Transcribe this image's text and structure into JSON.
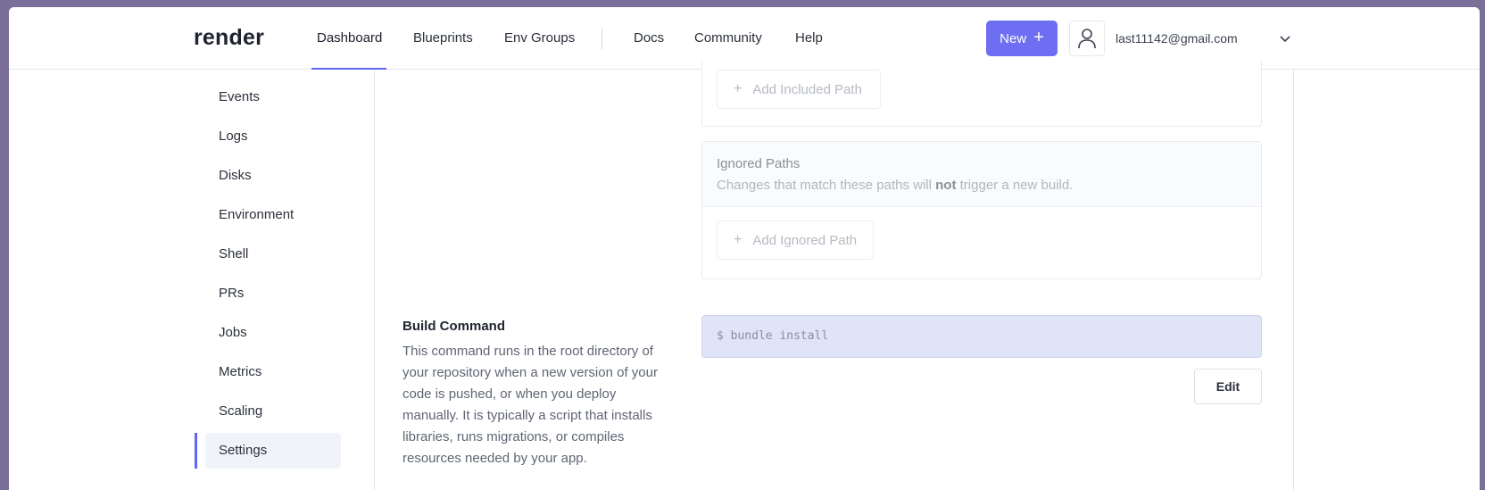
{
  "header": {
    "logo": "render",
    "nav": [
      {
        "label": "Dashboard"
      },
      {
        "label": "Blueprints"
      },
      {
        "label": "Env Groups"
      },
      {
        "label": "Docs"
      },
      {
        "label": "Community"
      },
      {
        "label": "Help"
      }
    ],
    "new_button": {
      "label": "New",
      "icon": "plus-icon"
    },
    "user": {
      "email": "last11142@gmail.com",
      "avatar_icon": "user-icon",
      "menu_icon": "chevron-down-icon"
    }
  },
  "sidebar": {
    "items": [
      {
        "label": "Events"
      },
      {
        "label": "Logs"
      },
      {
        "label": "Disks"
      },
      {
        "label": "Environment"
      },
      {
        "label": "Shell"
      },
      {
        "label": "PRs"
      },
      {
        "label": "Jobs"
      },
      {
        "label": "Metrics"
      },
      {
        "label": "Scaling"
      },
      {
        "label": "Settings"
      }
    ],
    "active": "Settings"
  },
  "included_paths": {
    "add_label": "Add Included Path"
  },
  "ignored_paths": {
    "title": "Ignored Paths",
    "desc_before": "Changes that match these paths will ",
    "desc_bold": "not",
    "desc_after": " trigger a new build.",
    "add_label": "Add Ignored Path"
  },
  "build_command": {
    "title": "Build Command",
    "description": "This command runs in the root directory of your repository when a new version of your code is pushed, or when you deploy manually. It is typically a script that installs libraries, runs migrations, or compiles resources needed by your app.",
    "prompt": "$",
    "command": "bundle install",
    "edit_label": "Edit"
  },
  "colors": {
    "accent": "#6366f1",
    "button": "#6d6ef2",
    "command_bg": "#dfe4f6"
  }
}
